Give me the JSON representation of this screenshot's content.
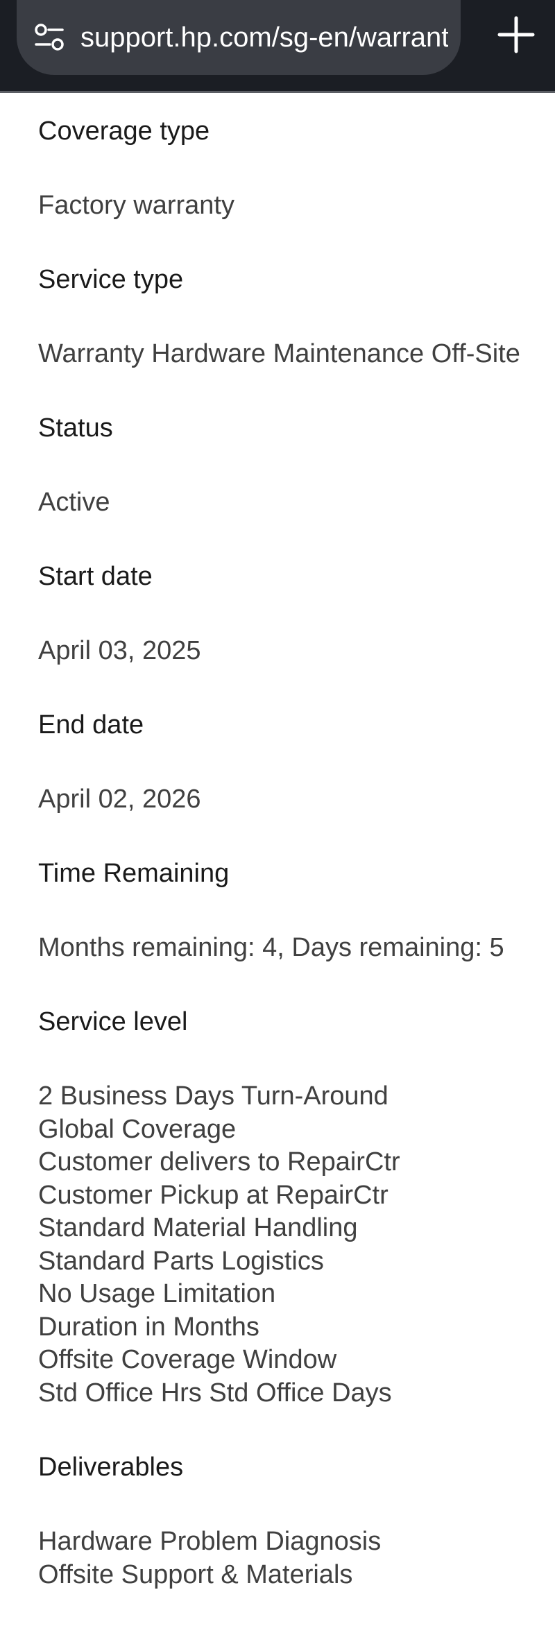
{
  "browser": {
    "url": "support.hp.com/sg-en/warrant",
    "new_tab_icon": "plus-icon",
    "site_info_icon": "tune-icon"
  },
  "warranty": {
    "coverage_type_label": "Coverage type",
    "coverage_type_value": "Factory warranty",
    "service_type_label": "Service type",
    "service_type_value": "Warranty Hardware Maintenance Off-Site",
    "status_label": "Status",
    "status_value": "Active",
    "start_date_label": "Start date",
    "start_date_value": "April 03, 2025",
    "end_date_label": "End date",
    "end_date_value": "April 02, 2026",
    "time_remaining_label": "Time Remaining",
    "time_remaining_value": "Months remaining: 4, Days remaining: 5",
    "service_level_label": "Service level",
    "service_level_items": [
      "2 Business Days Turn-Around",
      "Global Coverage",
      "Customer delivers to RepairCtr",
      "Customer Pickup at RepairCtr",
      "Standard Material Handling",
      "Standard Parts Logistics",
      "No Usage Limitation",
      "Duration in Months",
      "Offsite Coverage Window",
      "Std Office Hrs Std Office Days"
    ],
    "deliverables_label": "Deliverables",
    "deliverables_items": [
      "Hardware Problem Diagnosis",
      "Offsite Support & Materials"
    ]
  }
}
